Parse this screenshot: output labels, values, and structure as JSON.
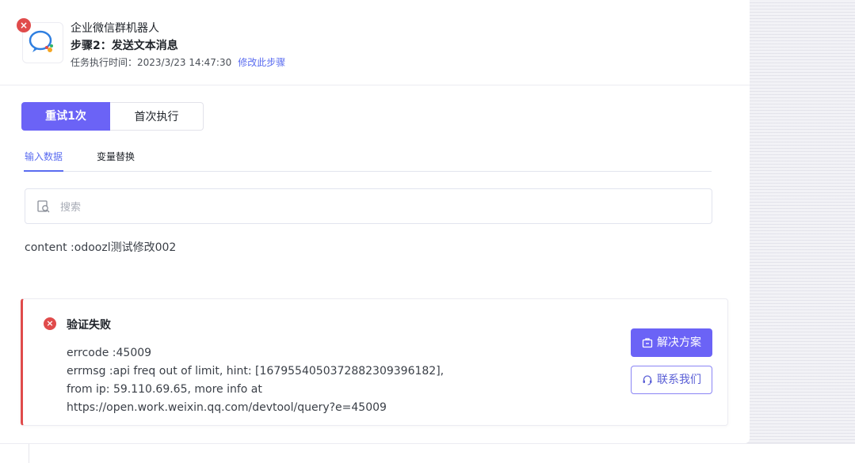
{
  "header": {
    "app_name": "企业微信群机器人",
    "step_title": "步骤2：发送文本消息",
    "exec_time_label": "任务执行时间：2023/3/23 14:47:30",
    "edit_link": "修改此步骤",
    "error_mark": "×"
  },
  "segments": {
    "retry": "重试1次",
    "first_run": "首次执行"
  },
  "tabs": {
    "input_data": "输入数据",
    "var_replace": "变量替换"
  },
  "search": {
    "placeholder": "搜索",
    "value": ""
  },
  "content_line": "content :odoozl测试修改002",
  "error_card": {
    "icon": "×",
    "title": "验证失败",
    "lines": [
      "errcode :45009",
      "errmsg :api freq out of limit, hint: [1679554050372882309396182],",
      "from ip: 59.110.69.65, more info at",
      "https://open.work.weixin.qq.com/devtool/query?e=45009"
    ],
    "solution_button": "解决方案",
    "contact_button": "联系我们"
  },
  "colors": {
    "accent": "#6b63f6",
    "link": "#5a6cf0",
    "error": "#e04b4b"
  }
}
